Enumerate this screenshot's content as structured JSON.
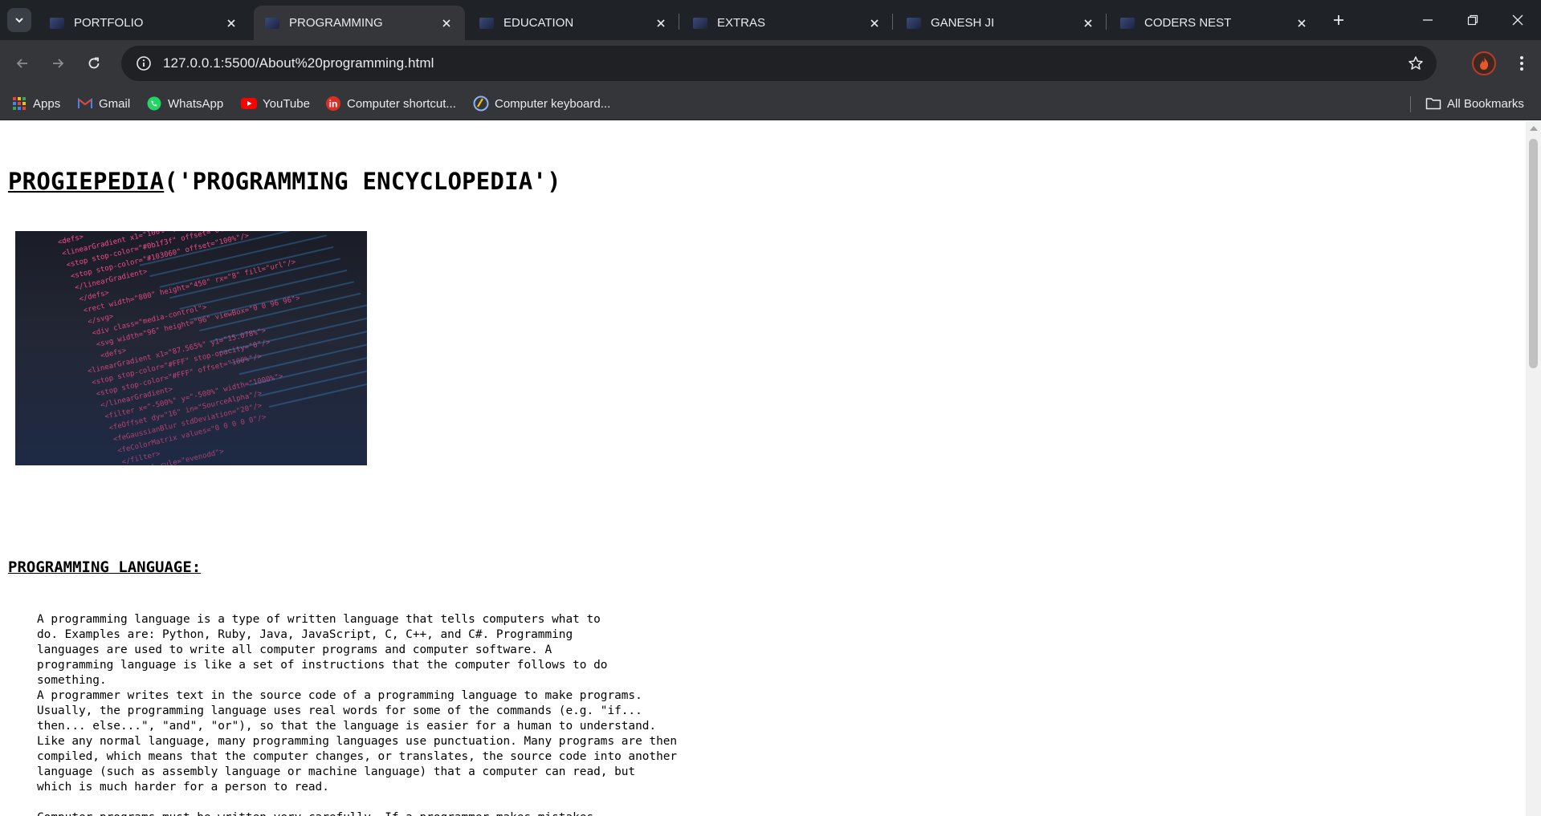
{
  "browser": {
    "tabs": [
      {
        "label": "PORTFOLIO",
        "active": false
      },
      {
        "label": "PROGRAMMING",
        "active": true
      },
      {
        "label": "EDUCATION",
        "active": false
      },
      {
        "label": "EXTRAS",
        "active": false
      },
      {
        "label": "GANESH JI",
        "active": false
      },
      {
        "label": "CODERS NEST",
        "active": false
      }
    ],
    "address_bar": {
      "url": "127.0.0.1:5500/About%20programming.html"
    },
    "bookmarks": [
      {
        "label": "Apps",
        "icon": "apps-grid-icon"
      },
      {
        "label": "Gmail",
        "icon": "gmail-icon"
      },
      {
        "label": "WhatsApp",
        "icon": "whatsapp-icon"
      },
      {
        "label": "YouTube",
        "icon": "youtube-icon"
      },
      {
        "label": "Computer shortcut...",
        "icon": "computer-shortcut-icon"
      },
      {
        "label": "Computer keyboard...",
        "icon": "computer-keyboard-icon"
      }
    ],
    "all_bookmarks_label": "All Bookmarks"
  },
  "page": {
    "title_brand": "PROGIEPEDIA",
    "title_rest": "('PROGRAMMING ENCYCLOPEDIA')",
    "section_heading": "PROGRAMMING LANGUAGE:",
    "paragraph_lines": [
      "A programming language is a type of written language that tells computers what to",
      "do. Examples are: Python, Ruby, Java, JavaScript, C, C++, and C#. Programming",
      "languages are used to write all computer programs and computer software. A",
      "programming language is like a set of instructions that the computer follows to do",
      "something.",
      "A programmer writes text in the source code of a programming language to make programs.",
      "Usually, the programming language uses real words for some of the commands (e.g. \"if...",
      "then... else...\", \"and\", \"or\"), so that the language is easier for a human to understand.",
      "Like any normal language, many programming languages use punctuation. Many programs are then",
      "compiled, which means that the computer changes, or translates, the source code into another",
      "language (such as assembly language or machine language) that a computer can read, but",
      "which is much harder for a person to read.",
      "",
      "Computer programs must be written very carefully. If a programmer makes mistakes"
    ],
    "hero_code_lines": [
      {
        "text": "<defs>",
        "color": "#ff4d8d"
      },
      {
        "text": "<linearGradient x1=\"100%\" y1=\"0%\" x2=\"0%\" y2=\"100%\">",
        "color": "#ff4d8d"
      },
      {
        "text": "<stop stop-color=\"#0b1f3f\" offset=\"0%\"/>",
        "color": "#ff4d8d"
      },
      {
        "text": "<stop stop-color=\"#103060\" offset=\"100%\"/>",
        "color": "#ff4d8d"
      },
      {
        "text": "</linearGradient>",
        "color": "#ff4d8d"
      },
      {
        "text": "</defs>",
        "color": "#ff4d8d"
      },
      {
        "text": "<rect width=\"800\" height=\"450\" rx=\"8\" fill=\"url\"/>",
        "color": "#ff4d8d"
      },
      {
        "text": "</svg>",
        "color": "#ff4d8d"
      },
      {
        "text": "<div class=\"media-control\">",
        "color": "#ff4d8d"
      },
      {
        "text": "<svg width=\"96\" height=\"96\" viewBox=\"0 0 96 96\">",
        "color": "#ff4d8d"
      },
      {
        "text": "<defs>",
        "color": "#ff4d8d"
      },
      {
        "text": "<linearGradient x1=\"87.565%\" y1=\"15.078%\">",
        "color": "#ff4d8d"
      },
      {
        "text": "<stop stop-color=\"#FFF\" stop-opacity=\"0\"/>",
        "color": "#ff4d8d"
      },
      {
        "text": "<stop stop-color=\"#FFF\" offset=\"100%\"/>",
        "color": "#ff4d8d"
      },
      {
        "text": "</linearGradient>",
        "color": "#ff4d8d"
      },
      {
        "text": "<filter x=\"-500%\" y=\"-500%\" width=\"1000%\">",
        "color": "#ff4d8d"
      },
      {
        "text": "<feOffset dy=\"16\" in=\"SourceAlpha\"/>",
        "color": "#ff4d8d"
      },
      {
        "text": "<feGaussianBlur stdDeviation=\"20\"/>",
        "color": "#ff4d8d"
      },
      {
        "text": "<feColorMatrix values=\"0 0 0 0 0\"/>",
        "color": "#ff4d8d"
      },
      {
        "text": "</filter>",
        "color": "#ff4d8d"
      },
      {
        "text": "<g fill-rule=\"evenodd\">",
        "color": "#ff4d8d"
      }
    ]
  },
  "colors": {
    "tabstrip_bg": "#1f2328",
    "toolbar_bg": "#35363a",
    "omnibox_bg": "#202124",
    "chrome_text": "#e8eaed",
    "page_bg": "#ffffff",
    "code_pink": "#ff4d8d",
    "code_blue": "#3d8fd6"
  }
}
